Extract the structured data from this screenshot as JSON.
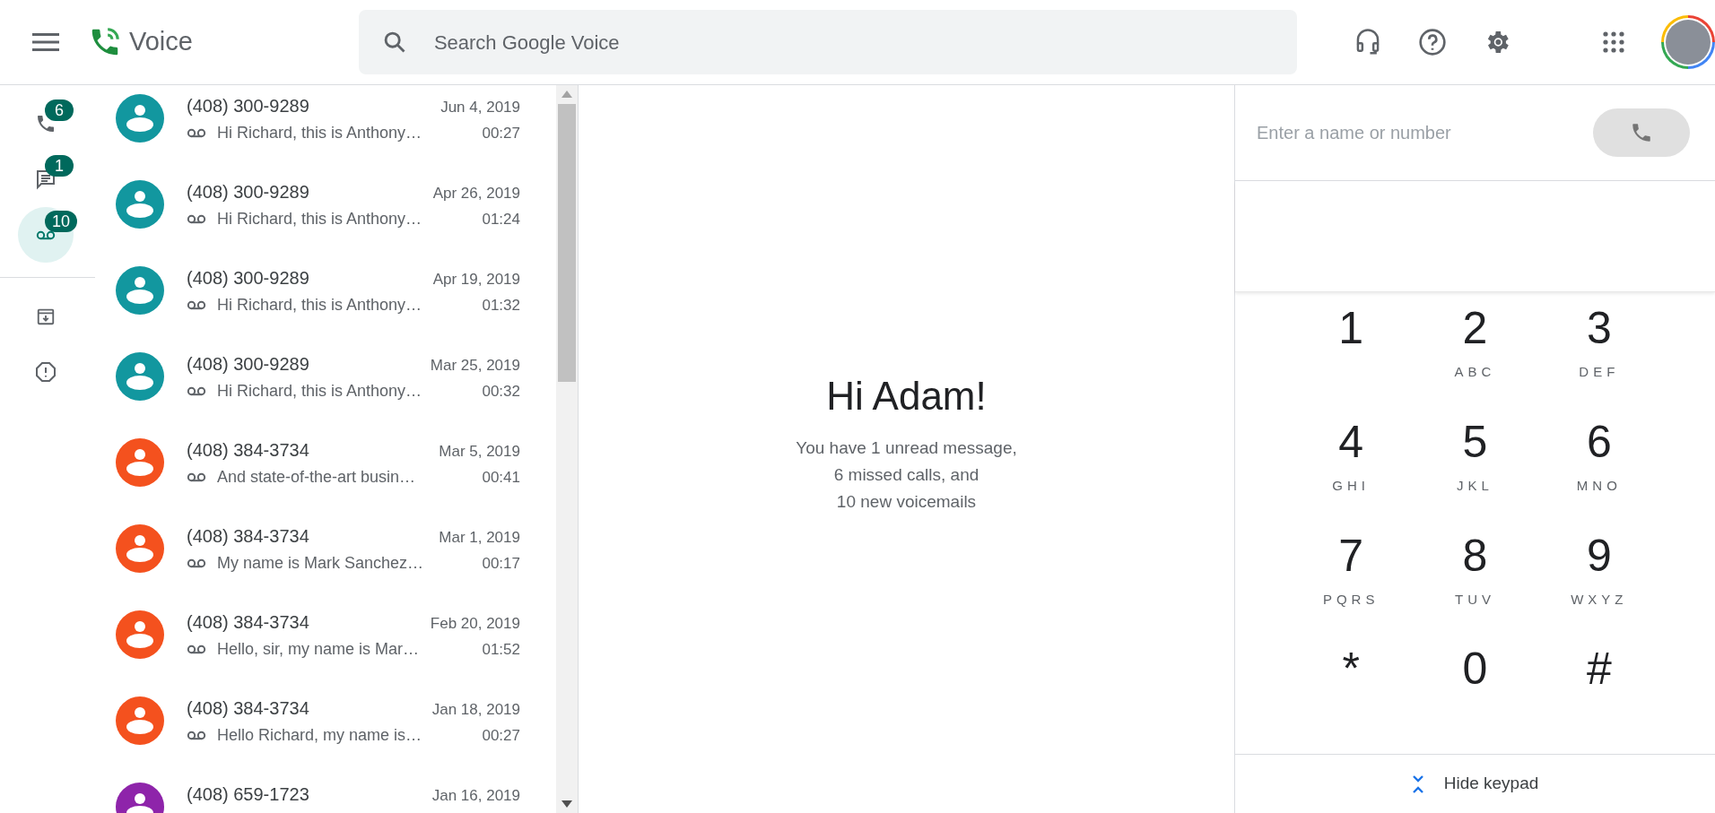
{
  "header": {
    "app_name": "Voice",
    "search": {
      "placeholder": "Search Google Voice"
    }
  },
  "nav": [
    {
      "kind": "calls",
      "badge": "6",
      "selected": false
    },
    {
      "kind": "messages",
      "badge": "1",
      "selected": false
    },
    {
      "kind": "voicemail",
      "badge": "10",
      "selected": true
    },
    {
      "kind": "archive",
      "selected": false
    },
    {
      "kind": "spam",
      "selected": false
    }
  ],
  "voicemails": [
    {
      "number": "(408) 300-9289",
      "date": "Jun 4, 2019",
      "preview": "Hi Richard, this is Anthony…",
      "duration": "00:27",
      "color": "#12979f"
    },
    {
      "number": "(408) 300-9289",
      "date": "Apr 26, 2019",
      "preview": "Hi Richard, this is Anthony…",
      "duration": "01:24",
      "color": "#12979f"
    },
    {
      "number": "(408) 300-9289",
      "date": "Apr 19, 2019",
      "preview": "Hi Richard, this is Anthony…",
      "duration": "01:32",
      "color": "#12979f"
    },
    {
      "number": "(408) 300-9289",
      "date": "Mar 25, 2019",
      "preview": "Hi Richard, this is Anthony…",
      "duration": "00:32",
      "color": "#12979f"
    },
    {
      "number": "(408) 384-3734",
      "date": "Mar 5, 2019",
      "preview": "And state-of-the-art busin…",
      "duration": "00:41",
      "color": "#f4511e"
    },
    {
      "number": "(408) 384-3734",
      "date": "Mar 1, 2019",
      "preview": "My name is Mark Sanchez…",
      "duration": "00:17",
      "color": "#f4511e"
    },
    {
      "number": "(408) 384-3734",
      "date": "Feb 20, 2019",
      "preview": "Hello, sir, my name is Mar…",
      "duration": "01:52",
      "color": "#f4511e"
    },
    {
      "number": "(408) 384-3734",
      "date": "Jan 18, 2019",
      "preview": "Hello Richard, my name is…",
      "duration": "00:27",
      "color": "#f4511e"
    },
    {
      "number": "(408) 659-1723",
      "date": "Jan 16, 2019",
      "color": "#8e24aa"
    }
  ],
  "welcome": {
    "title": "Hi Adam!",
    "lines": [
      "You have 1 unread message,",
      "6 missed calls, and",
      "10 new voicemails"
    ]
  },
  "dialer": {
    "placeholder": "Enter a name or number",
    "keys": [
      {
        "digit": "1"
      },
      {
        "digit": "2",
        "letters": "ABC"
      },
      {
        "digit": "3",
        "letters": "DEF"
      },
      {
        "digit": "4",
        "letters": "GHI"
      },
      {
        "digit": "5",
        "letters": "JKL"
      },
      {
        "digit": "6",
        "letters": "MNO"
      },
      {
        "digit": "7",
        "letters": "PQRS"
      },
      {
        "digit": "8",
        "letters": "TUV"
      },
      {
        "digit": "9",
        "letters": "WXYZ"
      },
      {
        "digit": "*"
      },
      {
        "digit": "0"
      },
      {
        "digit": "#"
      }
    ],
    "hide_keypad": "Hide keypad"
  }
}
